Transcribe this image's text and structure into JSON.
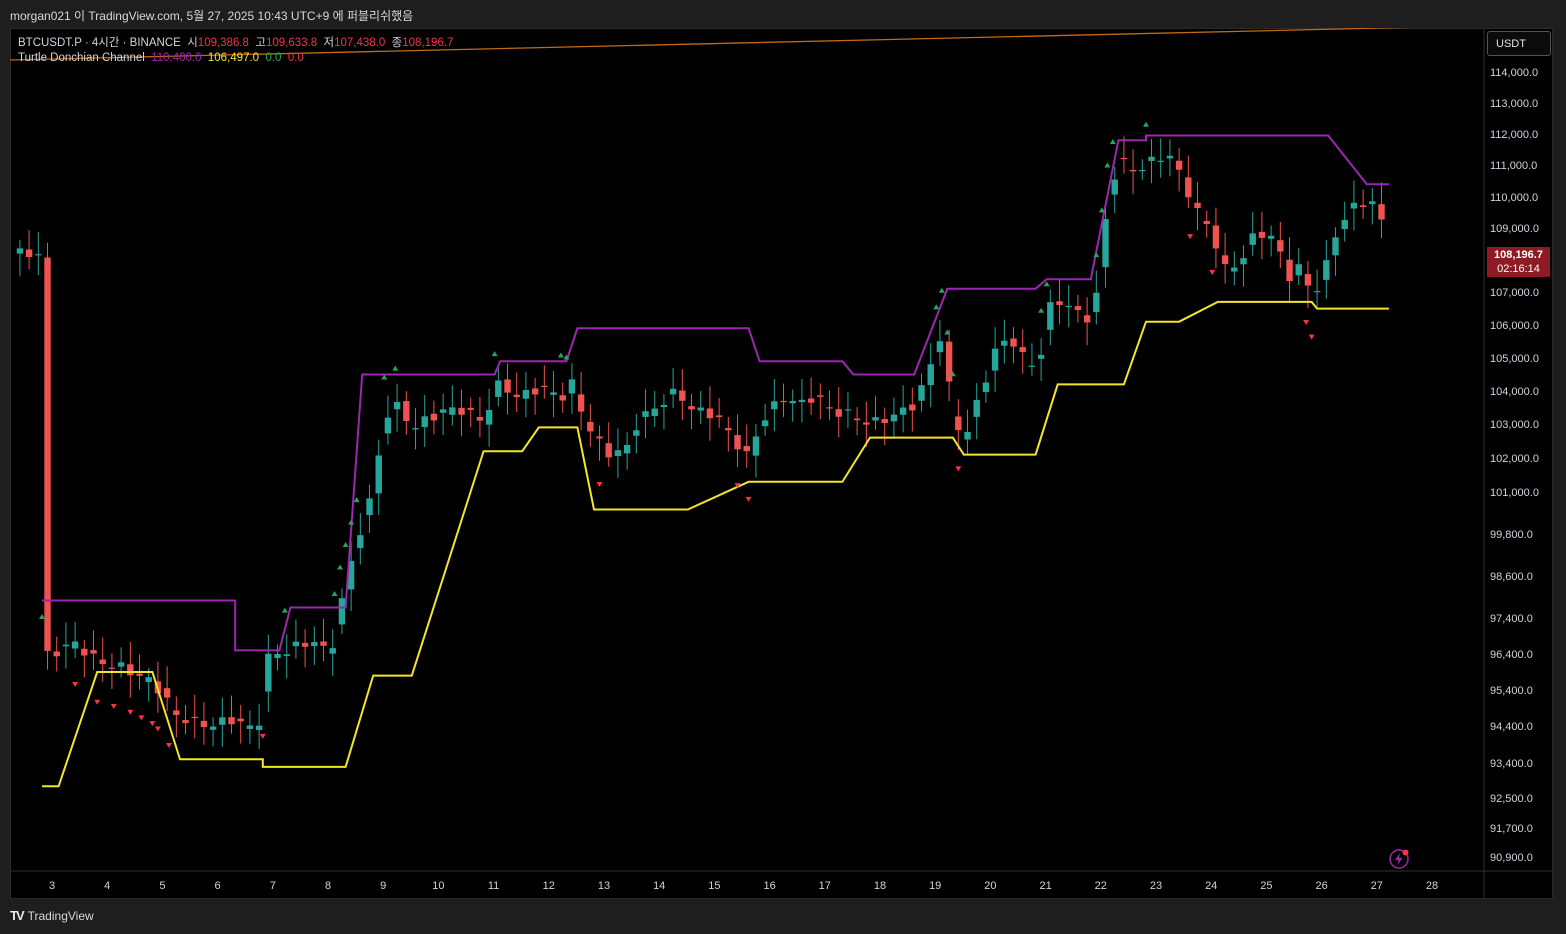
{
  "topbar": {
    "publish_text": "morgan021 이 TradingView.com, 5월 27, 2025 10:43 UTC+9 에 퍼블리쉬했음"
  },
  "legend": {
    "symbol": "BTCUSDT.P · 4시간 · BINANCE",
    "open_label": "시",
    "open_value": "109,386.8",
    "high_label": "고",
    "high_value": "109,633.8",
    "low_label": "저",
    "low_value": "107,438.0",
    "close_label": "종",
    "close_value": "108,196.7",
    "indicator_name": "Turtle Donchian Channel",
    "indicator_upper": "110,400.0",
    "indicator_lower": "106,497.0",
    "indicator_v3": "0.0",
    "indicator_v4": "0.0"
  },
  "currency_label": "USDT",
  "price_badge": {
    "price": "108,196.7",
    "countdown": "02:16:14"
  },
  "footer": {
    "brand": "TradingView"
  },
  "colors": {
    "up": "#26a69a",
    "down": "#ef5350",
    "upper_channel": "#9c27b0",
    "lower_channel": "#f3e52b",
    "long_trend": "#c26a10",
    "badge": "#8e1b24"
  },
  "chart_data": {
    "type": "candlestick",
    "symbol": "BTCUSDT.P",
    "timeframe": "4시간",
    "y_axis": {
      "scale": "log",
      "ticks": [
        "114,000.0",
        "113,000.0",
        "112,000.0",
        "111,000.0",
        "110,000.0",
        "109,000.0",
        "107,000.0",
        "106,000.0",
        "105,000.0",
        "104,000.0",
        "103,000.0",
        "102,000.0",
        "101,000.0",
        "99,800.0",
        "98,600.0",
        "97,400.0",
        "96,400.0",
        "95,400.0",
        "94,400.0",
        "93,400.0",
        "92,500.0",
        "91,700.0",
        "90,900.0"
      ]
    },
    "x_axis": {
      "ticks": [
        "3",
        "4",
        "5",
        "6",
        "7",
        "8",
        "9",
        "10",
        "11",
        "12",
        "13",
        "14",
        "15",
        "16",
        "17",
        "18",
        "19",
        "20",
        "21",
        "22",
        "23",
        "24",
        "25",
        "26",
        "27",
        "28"
      ]
    },
    "last_price": 108196.7,
    "donchian_upper_levels": [
      {
        "from": "3",
        "to": "6.5",
        "value": 97900
      },
      {
        "from": "6.5",
        "to": "7.3",
        "value": 96500
      },
      {
        "from": "7.5",
        "to": "8.5",
        "value": 97700
      },
      {
        "from": "8.8",
        "to": "11.2",
        "value": 104500
      },
      {
        "from": "11.3",
        "to": "12.5",
        "value": 104900
      },
      {
        "from": "12.7",
        "to": "15.8",
        "value": 105900
      },
      {
        "from": "16",
        "to": "17.5",
        "value": 104900
      },
      {
        "from": "17.7",
        "to": "18.8",
        "value": 104500
      },
      {
        "from": "19.4",
        "to": "21.0",
        "value": 107100
      },
      {
        "from": "21.2",
        "to": "22",
        "value": 107400
      },
      {
        "from": "22.5",
        "to": "23",
        "value": 111800
      },
      {
        "from": "23",
        "to": "26.3",
        "value": 111950
      },
      {
        "from": "27",
        "to": "27.4",
        "value": 110400
      }
    ],
    "donchian_lower_levels": [
      {
        "from": "3",
        "to": "3.3",
        "value": 92800
      },
      {
        "from": "4",
        "to": "5",
        "value": 95900
      },
      {
        "from": "5.5",
        "to": "7",
        "value": 93500
      },
      {
        "from": "7",
        "to": "8.5",
        "value": 93300
      },
      {
        "from": "9",
        "to": "9.7",
        "value": 95800
      },
      {
        "from": "11",
        "to": "11.7",
        "value": 102200
      },
      {
        "from": "12",
        "to": "12.7",
        "value": 102900
      },
      {
        "from": "13",
        "to": "14.7",
        "value": 100500
      },
      {
        "from": "15.8",
        "to": "17.5",
        "value": 101300
      },
      {
        "from": "18",
        "to": "19.5",
        "value": 102600
      },
      {
        "from": "19.7",
        "to": "21",
        "value": 102100
      },
      {
        "from": "21.4",
        "to": "22.6",
        "value": 104200
      },
      {
        "from": "23",
        "to": "23.6",
        "value": 106100
      },
      {
        "from": "24.3",
        "to": "26",
        "value": 106700
      },
      {
        "from": "26.1",
        "to": "27.4",
        "value": 106497
      }
    ]
  }
}
